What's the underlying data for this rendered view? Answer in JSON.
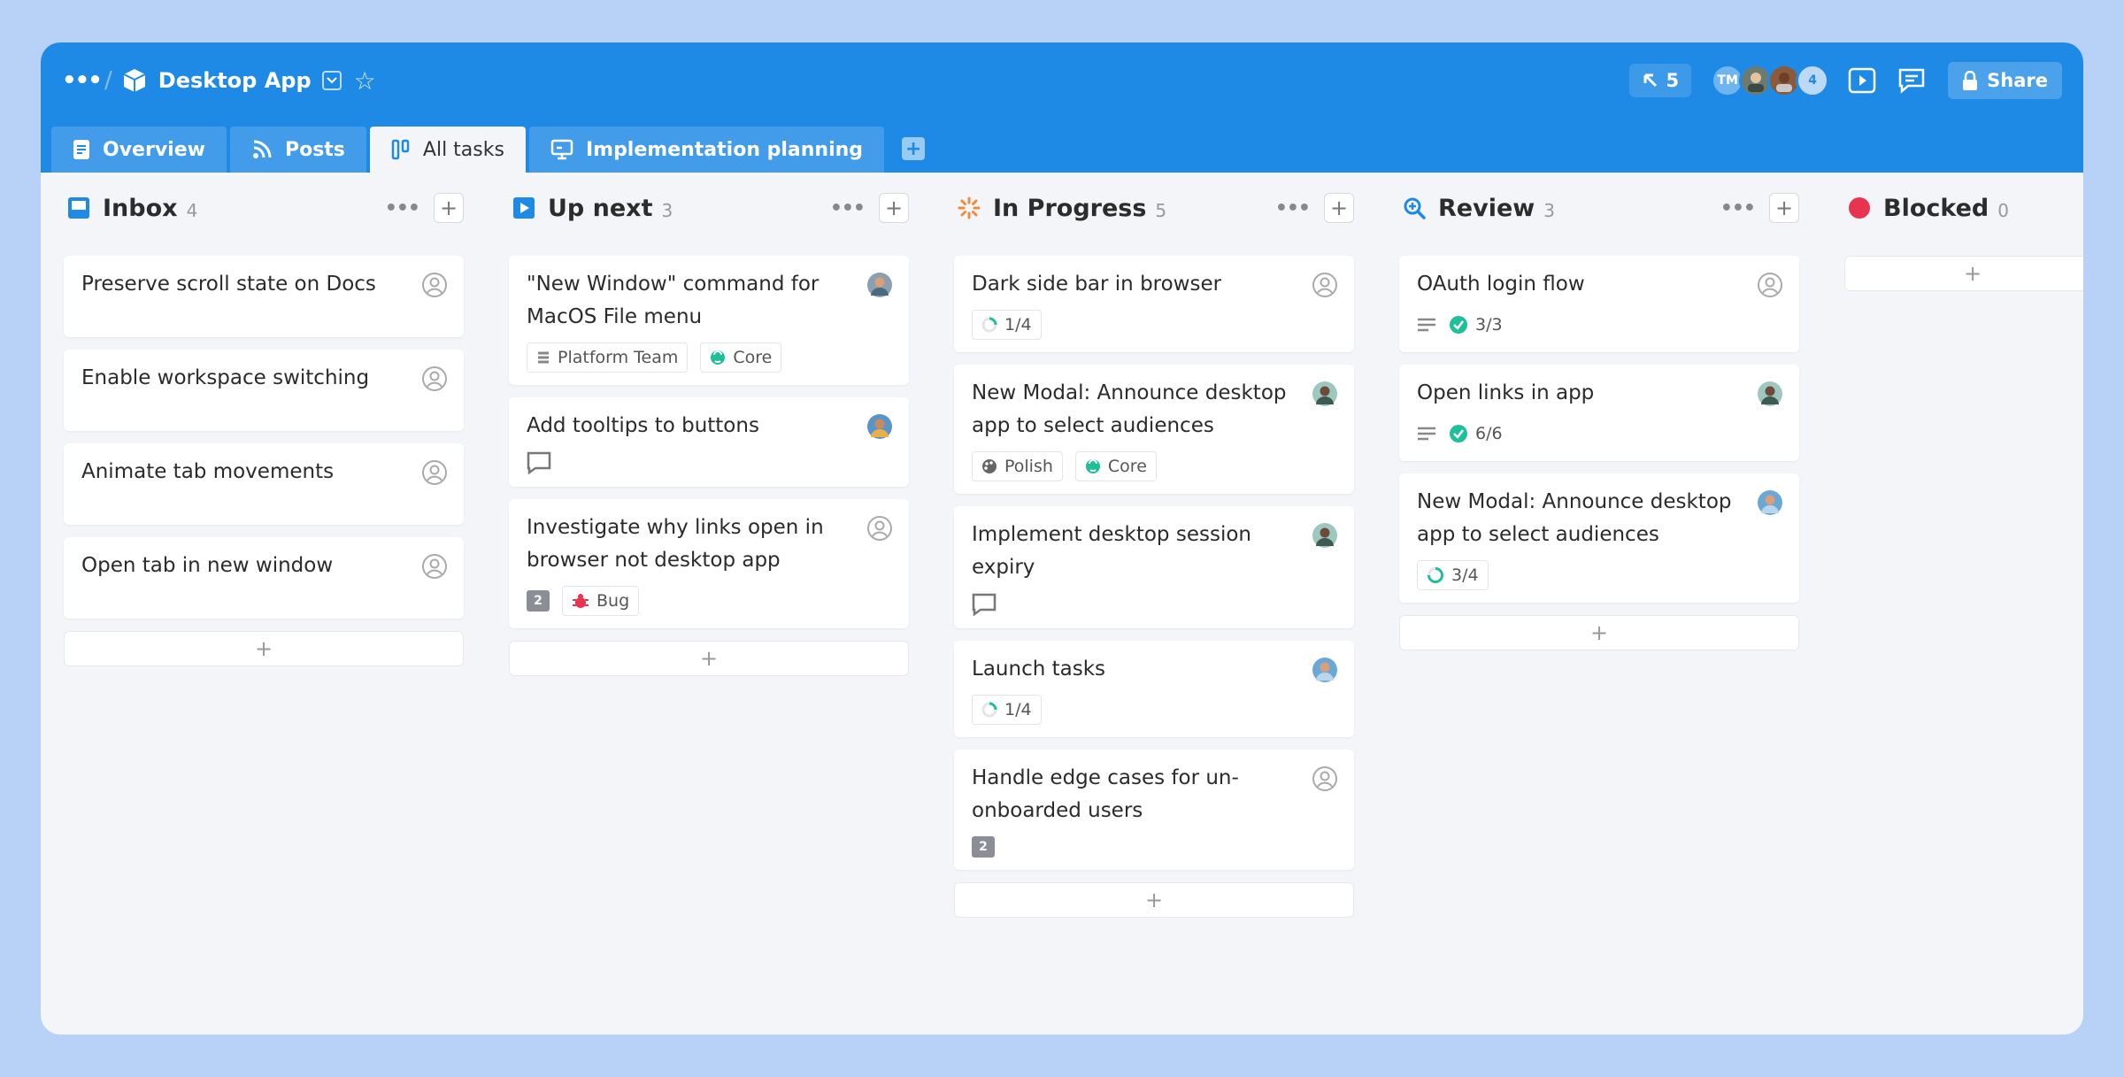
{
  "header": {
    "app_title": "Desktop App",
    "cursor_count": "5",
    "avatars": [
      {
        "initials": "TM"
      },
      {
        "initials": ""
      },
      {
        "initials": ""
      },
      {
        "initials": "4"
      }
    ],
    "share_label": "Share"
  },
  "tabs": [
    {
      "label": "Overview",
      "icon": "document-icon"
    },
    {
      "label": "Posts",
      "icon": "rss-icon"
    },
    {
      "label": "All tasks",
      "icon": "kanban-icon",
      "active": true
    },
    {
      "label": "Implementation planning",
      "icon": "presentation-icon"
    }
  ],
  "columns": [
    {
      "title": "Inbox",
      "count": "4",
      "icon": "inbox-icon",
      "cards": [
        {
          "title": "Preserve scroll state on Docs",
          "assignee": "unassigned"
        },
        {
          "title": "Enable workspace switching",
          "assignee": "unassigned"
        },
        {
          "title": "Animate tab movements",
          "assignee": "unassigned"
        },
        {
          "title": "Open tab in new window",
          "assignee": "unassigned"
        }
      ]
    },
    {
      "title": "Up next",
      "count": "3",
      "icon": "play-icon",
      "cards": [
        {
          "title": "\"New Window\" command for MacOS File menu",
          "assignee": "user",
          "tags": [
            "Platform Team",
            "Core"
          ]
        },
        {
          "title": "Add tooltips to buttons",
          "assignee": "user",
          "comments": true
        },
        {
          "title": "Investigate why links open in browser not desktop app",
          "assignee": "unassigned",
          "comment_count": "2",
          "tags": [
            "Bug"
          ]
        }
      ]
    },
    {
      "title": "In Progress",
      "count": "5",
      "icon": "spinner-icon",
      "cards": [
        {
          "title": "Dark side bar in browser",
          "assignee": "unassigned",
          "progress": "1/4"
        },
        {
          "title": "New Modal: Announce desktop app to select audiences",
          "assignee": "user",
          "tags": [
            "Polish",
            "Core"
          ]
        },
        {
          "title": "Implement desktop session expiry",
          "assignee": "user",
          "comments": true
        },
        {
          "title": "Launch tasks",
          "assignee": "user",
          "progress": "1/4"
        },
        {
          "title": "Handle edge cases for un-onboarded users",
          "assignee": "unassigned",
          "comment_count": "2"
        }
      ]
    },
    {
      "title": "Review",
      "count": "3",
      "icon": "magnifier-icon",
      "cards": [
        {
          "title": "OAuth login flow",
          "assignee": "unassigned",
          "checks": "3/3"
        },
        {
          "title": "Open links in app",
          "assignee": "user",
          "checks": "6/6"
        },
        {
          "title": "New Modal: Announce desktop app to select audiences",
          "assignee": "user",
          "progress": "3/4"
        }
      ]
    },
    {
      "title": "Blocked",
      "count": "0",
      "icon": "red-dot-icon",
      "cards": []
    }
  ],
  "colors": {
    "topbar": "#1e8ae5",
    "background": "#b8d2f7",
    "board": "#f3f5f8",
    "blocked": "#e8344e",
    "check": "#1fbf9a"
  }
}
